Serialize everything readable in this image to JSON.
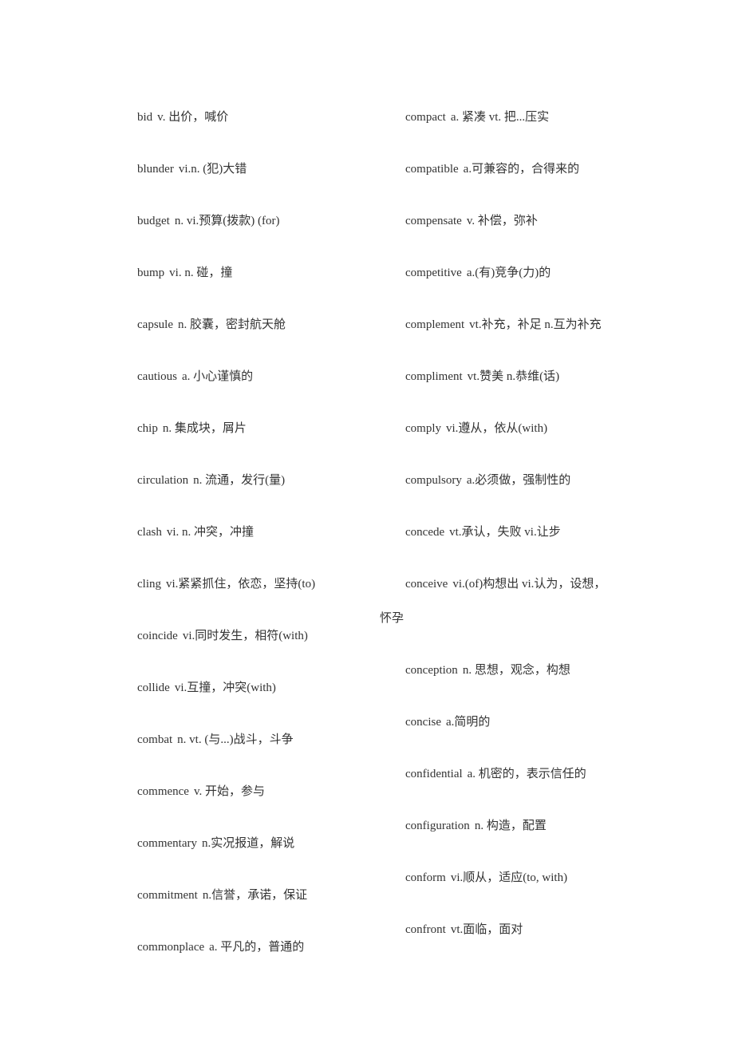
{
  "left_column": [
    {
      "word": "bid",
      "definition": "v. 出价，喊价"
    },
    {
      "word": "blunder",
      "definition": "vi.n. (犯)大错"
    },
    {
      "word": "budget",
      "definition": "n. vi.预算(拨款) (for)"
    },
    {
      "word": "bump",
      "definition": "vi. n. 碰，撞"
    },
    {
      "word": "capsule",
      "definition": "n. 胶囊，密封航天舱"
    },
    {
      "word": "cautious",
      "definition": "a. 小心谨慎的"
    },
    {
      "word": "chip",
      "definition": "n. 集成块，屑片"
    },
    {
      "word": "circulation",
      "definition": "n. 流通，发行(量)"
    },
    {
      "word": "clash",
      "definition": "vi. n. 冲突，冲撞"
    },
    {
      "word": "cling",
      "definition": "vi.紧紧抓住，依恋，坚持(to)"
    },
    {
      "word": "coincide",
      "definition": "vi.同时发生，相符(with)"
    },
    {
      "word": "collide",
      "definition": "vi.互撞，冲突(with)"
    },
    {
      "word": "combat",
      "definition": "n. vt. (与...)战斗，斗争"
    },
    {
      "word": "commence",
      "definition": "v. 开始，参与"
    },
    {
      "word": "commentary",
      "definition": "n.实况报道，解说"
    },
    {
      "word": "commitment",
      "definition": "n.信誉，承诺，保证"
    },
    {
      "word": "commonplace",
      "definition": "a. 平凡的，普通的"
    }
  ],
  "right_column": [
    {
      "word": "compact",
      "definition": "a. 紧凑 vt. 把...压实"
    },
    {
      "word": "compatible",
      "definition": "a.可兼容的，合得来的"
    },
    {
      "word": "compensate",
      "definition": "v. 补偿，弥补"
    },
    {
      "word": "competitive",
      "definition": "a.(有)竞争(力)的"
    },
    {
      "word": "complement",
      "definition": "vt.补充，补足 n.互为补充"
    },
    {
      "word": "compliment",
      "definition": "vt.赞美 n.恭维(话)"
    },
    {
      "word": "comply",
      "definition": "vi.遵从，依从(with)"
    },
    {
      "word": "compulsory",
      "definition": "a.必须做，强制性的"
    },
    {
      "word": "concede",
      "definition": "vt.承认，失败 vi.让步"
    },
    {
      "word": "conceive",
      "definition": "vi.(of)构想出 vi.认为，设想，"
    },
    {
      "word": "conception",
      "definition": "n. 思想，观念，构想"
    },
    {
      "word": "concise",
      "definition": "a.简明的"
    },
    {
      "word": "confidential",
      "definition": "a. 机密的，表示信任的"
    },
    {
      "word": "configuration",
      "definition": "n. 构造，配置"
    },
    {
      "word": "conform",
      "definition": "vi.顺从，适应(to, with)"
    },
    {
      "word": "confront",
      "definition": "vt.面临，面对"
    }
  ],
  "conceive_continuation": "怀孕"
}
